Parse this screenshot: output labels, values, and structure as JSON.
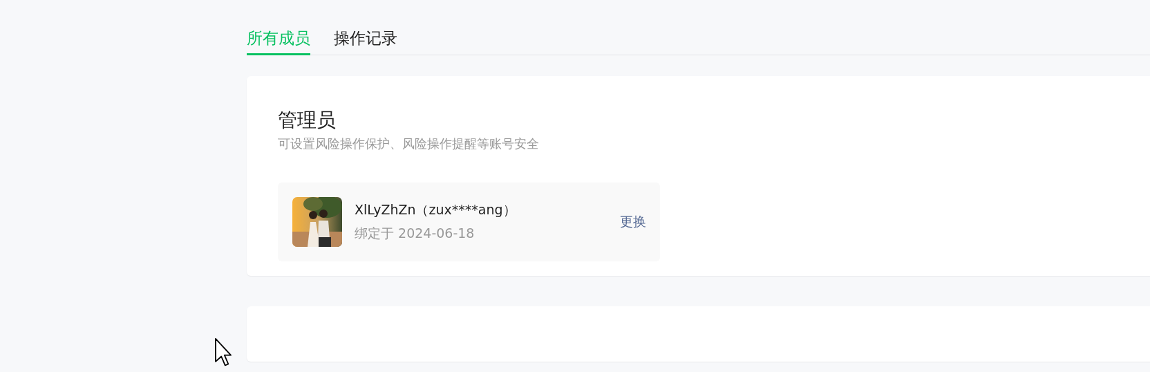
{
  "tabs": [
    {
      "label": "所有成员",
      "selected": true
    },
    {
      "label": "操作记录",
      "selected": false
    }
  ],
  "admin_card": {
    "title": "管理员",
    "subtitle": "可设置风险操作保护、风险操作提醒等账号安全",
    "member": {
      "name": "XlLyZhZn（zux****ang）",
      "bound_date": "绑定于 2024-06-18",
      "action": "更换"
    }
  }
}
